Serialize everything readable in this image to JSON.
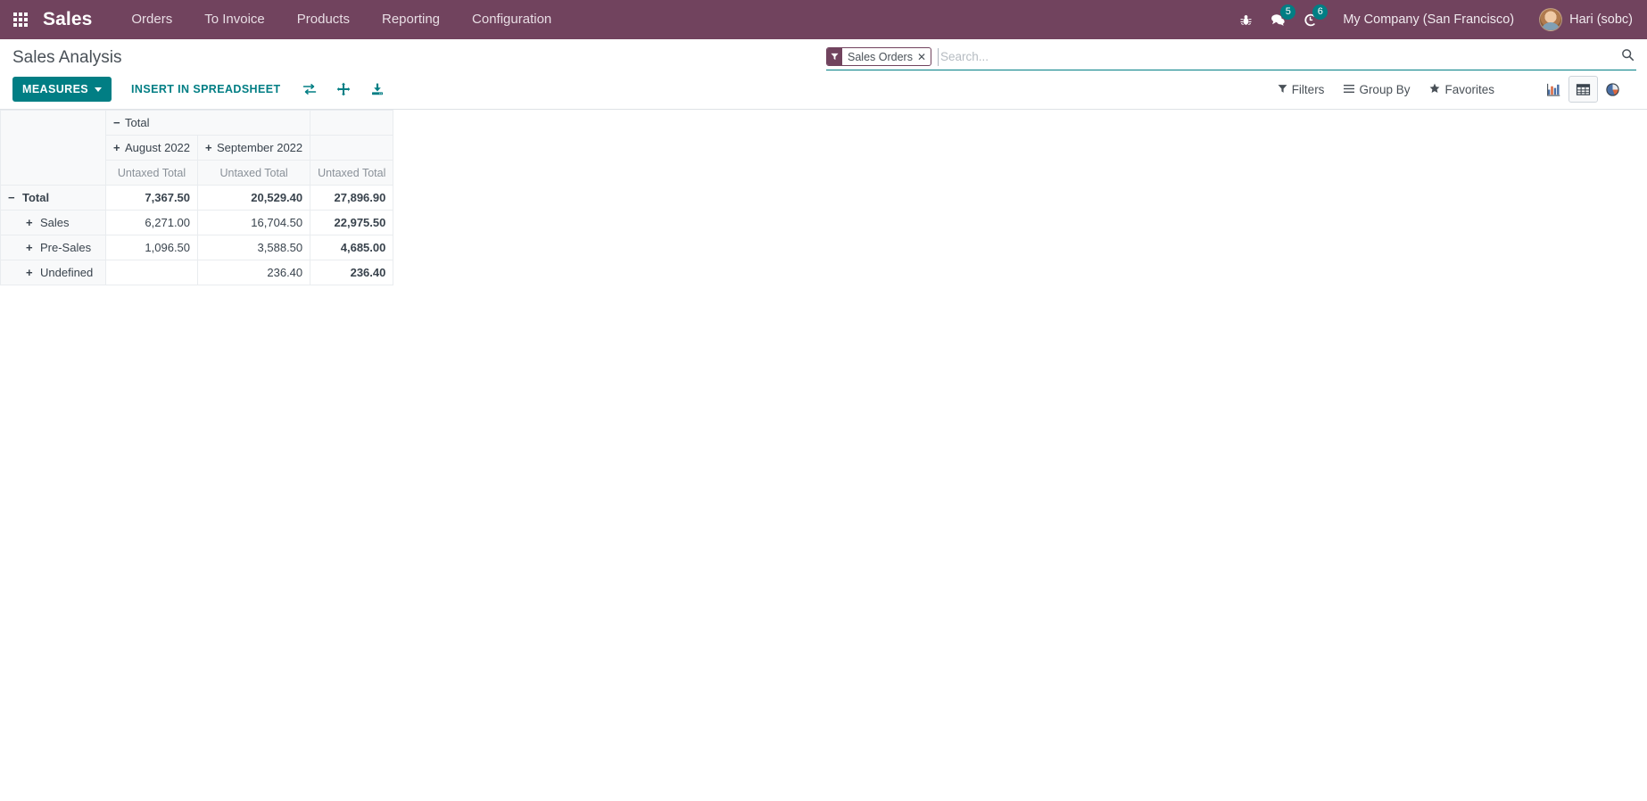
{
  "navbar": {
    "apps_icon": "apps-grid-icon",
    "brand": "Sales",
    "menu": [
      {
        "label": "Orders"
      },
      {
        "label": "To Invoice"
      },
      {
        "label": "Products"
      },
      {
        "label": "Reporting"
      },
      {
        "label": "Configuration"
      }
    ],
    "systray": {
      "bug_icon": "bug-icon",
      "messages_icon": "chat-bubble-icon",
      "messages_count": "5",
      "activities_icon": "clock-activity-icon",
      "activities_count": "6"
    },
    "company": "My Company (San Francisco)",
    "user": "Hari (sobc)",
    "accent_color": "#71435e"
  },
  "control_panel": {
    "title": "Sales Analysis",
    "measures_label": "MEASURES",
    "insert_spreadsheet_label": "INSERT IN SPREADSHEET",
    "icons": {
      "flip_axis": "flip-axis-icon",
      "expand_all": "expand-all-icon",
      "download": "download-xlsx-icon"
    },
    "accent_color": "#017e84"
  },
  "search": {
    "facet_label": "Sales Orders",
    "facet_icon": "filter-funnel-icon",
    "facet_remove_icon": "close-icon",
    "placeholder": "Search...",
    "value": "",
    "magnifier_icon": "search-icon"
  },
  "filter_menus": [
    {
      "label": "Filters",
      "icon": "filter-funnel-icon"
    },
    {
      "label": "Group By",
      "icon": "group-bars-icon"
    },
    {
      "label": "Favorites",
      "icon": "star-icon"
    }
  ],
  "view_switcher": [
    {
      "name": "graph",
      "icon": "bar-chart-icon",
      "active": false
    },
    {
      "name": "pivot",
      "icon": "pivot-table-icon",
      "active": true
    },
    {
      "name": "cohort",
      "icon": "pie-chart-icon",
      "active": false
    }
  ],
  "pivot": {
    "column_group_root": {
      "label": "Total",
      "toggle": "−"
    },
    "column_groups": [
      {
        "label": "August 2022",
        "toggle": "+"
      },
      {
        "label": "September 2022",
        "toggle": "+"
      }
    ],
    "measure_label": "Untaxed Total",
    "measure_headers": [
      "Untaxed Total",
      "Untaxed Total",
      "Untaxed Total"
    ],
    "rows": [
      {
        "label": "Total",
        "toggle": "−",
        "indent": 0,
        "total_row": true,
        "values": [
          "7,367.50",
          "20,529.40",
          "27,896.90"
        ]
      },
      {
        "label": "Sales",
        "toggle": "+",
        "indent": 1,
        "total_row": false,
        "values": [
          "6,271.00",
          "16,704.50",
          "22,975.50"
        ]
      },
      {
        "label": "Pre-Sales",
        "toggle": "+",
        "indent": 1,
        "total_row": false,
        "values": [
          "1,096.50",
          "3,588.50",
          "4,685.00"
        ]
      },
      {
        "label": "Undefined",
        "toggle": "+",
        "indent": 1,
        "total_row": false,
        "values": [
          "",
          "236.40",
          "236.40"
        ]
      }
    ]
  }
}
